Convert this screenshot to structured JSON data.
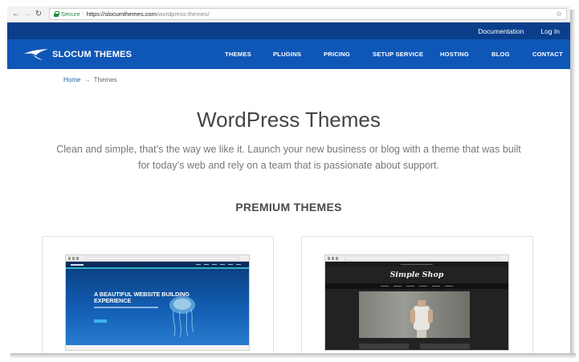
{
  "browser": {
    "secure_label": "Secure",
    "url_host": "https://slocumthemes.com",
    "url_path": "/wordpress-themes/",
    "icons": [
      "back-arrow-icon",
      "forward-arrow-icon",
      "reload-icon",
      "lock-icon",
      "star-icon"
    ]
  },
  "topbar": {
    "links": [
      "Documentation",
      "Log In"
    ]
  },
  "nav": {
    "brand": "SLOCUM THEMES",
    "items": [
      "THEMES",
      "PLUGINS",
      "PRICING",
      "SETUP SERVICE",
      "HOSTING",
      "BLOG",
      "CONTACT"
    ]
  },
  "breadcrumb": {
    "home": "Home",
    "separator": "→",
    "current": "Themes"
  },
  "page": {
    "title": "WordPress Themes",
    "tagline": "Clean and simple, that’s the way we like it. Launch your new business or blog with a theme that was built for today’s web and rely on a team that is passionate about support.",
    "section_title": "PREMIUM THEMES"
  },
  "cards": [
    {
      "headline": "A BEAUTIFUL WEBSITE BUILDING EXPERIENCE"
    },
    {
      "headline": "Simple Shop"
    }
  ],
  "colors": {
    "topbar": "#0b3f8c",
    "nav": "#0f57b7",
    "link": "#1d5ea8",
    "secure": "#1a8a3a"
  }
}
